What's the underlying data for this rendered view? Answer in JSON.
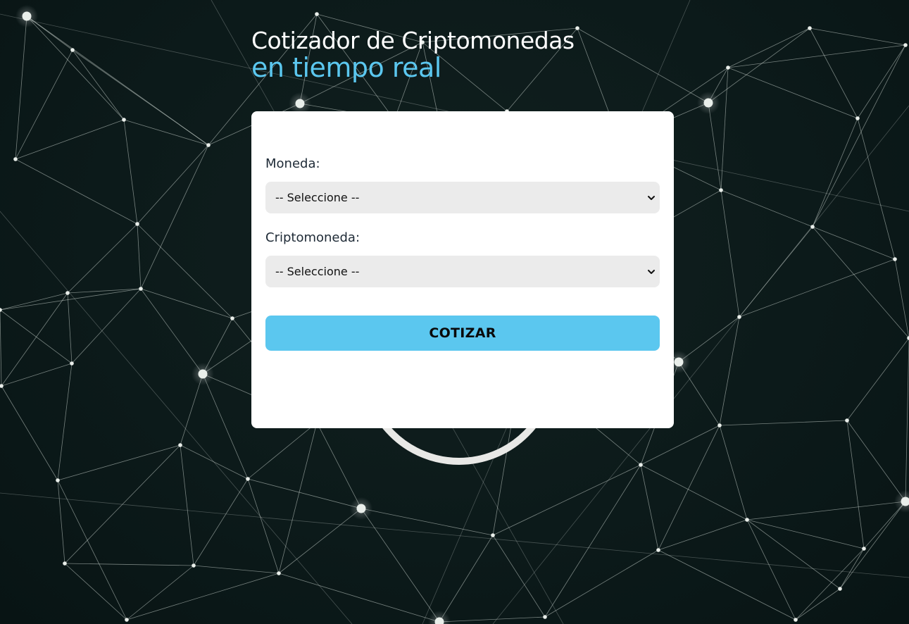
{
  "header": {
    "title_line1": "Cotizador de Criptomonedas",
    "title_line2": "en tiempo real"
  },
  "form": {
    "currency_label": "Moneda:",
    "currency_selected": "-- Seleccione --",
    "crypto_label": "Criptomoneda:",
    "crypto_selected": "-- Seleccione --",
    "submit_label": "COTIZAR"
  },
  "colors": {
    "accent": "#5bc7ef",
    "background": "#0c1a1a",
    "card": "#ffffff",
    "select_bg": "#ebebeb"
  },
  "icons": {
    "select_arrow": "chevron-down-icon"
  }
}
